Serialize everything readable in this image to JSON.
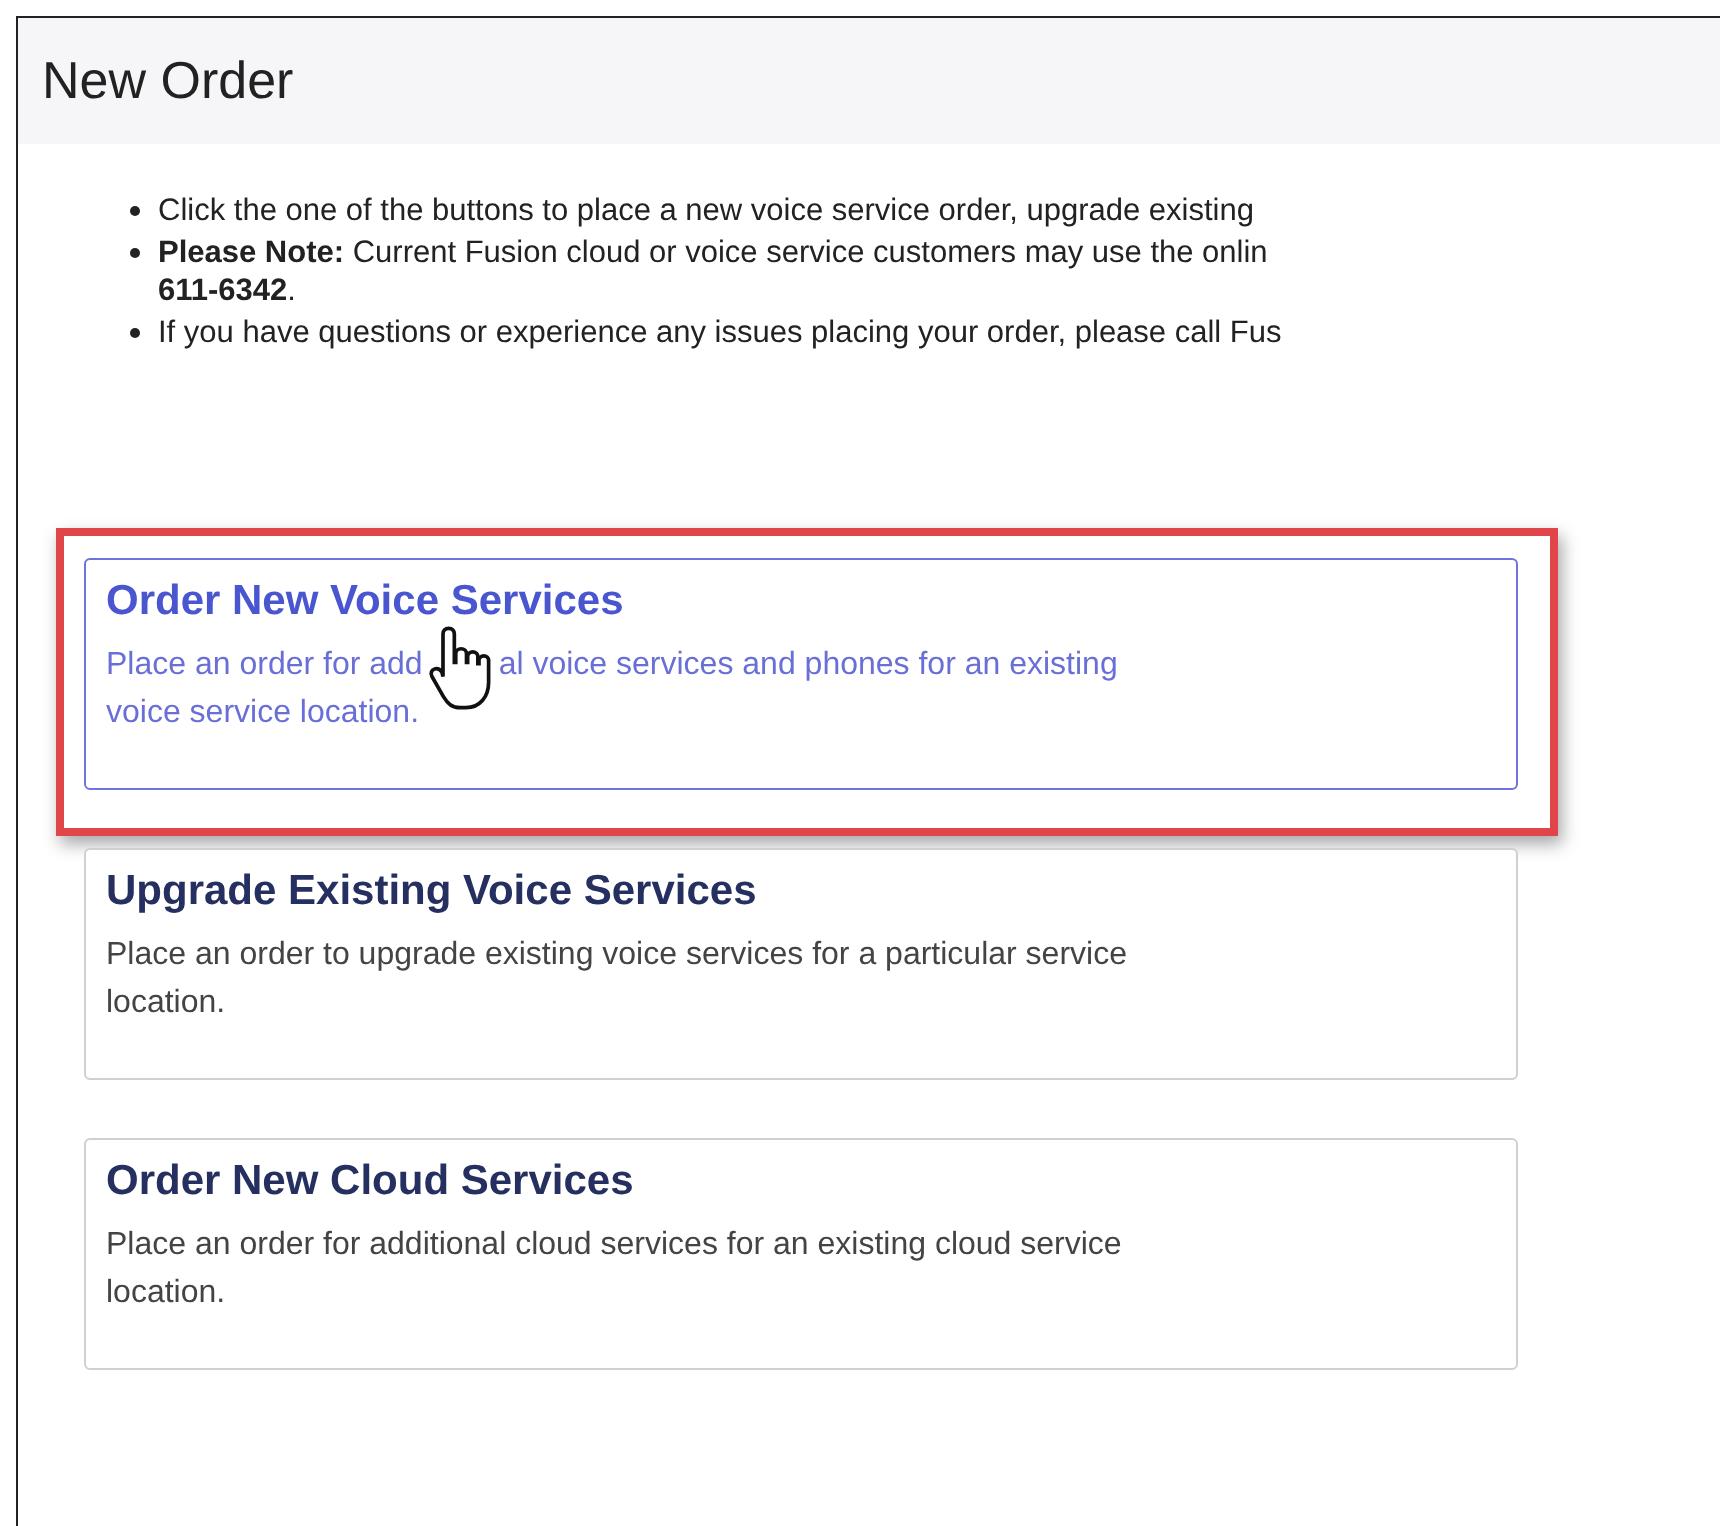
{
  "page": {
    "title": "New Order"
  },
  "instructions": [
    {
      "lines": [
        "Click the one of the buttons to place a new voice service order, upgrade existing"
      ]
    },
    {
      "lines": [
        "**Please Note:** Current Fusion cloud or voice service customers may use the onlin",
        "**611-6342**."
      ]
    },
    {
      "lines": [
        "If you have questions or experience any issues placing your order, please call Fus"
      ]
    }
  ],
  "options": [
    {
      "title": "Order New Voice Services",
      "description_lines": [
        [
          "Place an order for add",
          "al voice services and phones for an existing"
        ],
        [
          "voice service location."
        ]
      ],
      "highlighted": true
    },
    {
      "title": "Upgrade Existing Voice Services",
      "description_lines": [
        [
          "Place an order to upgrade existing voice services for a particular service"
        ],
        [
          "location."
        ]
      ],
      "highlighted": false
    },
    {
      "title": "Order New Cloud Services",
      "description_lines": [
        [
          "Place an order for additional cloud services for an existing cloud service"
        ],
        [
          "location."
        ]
      ],
      "highlighted": false
    }
  ]
}
